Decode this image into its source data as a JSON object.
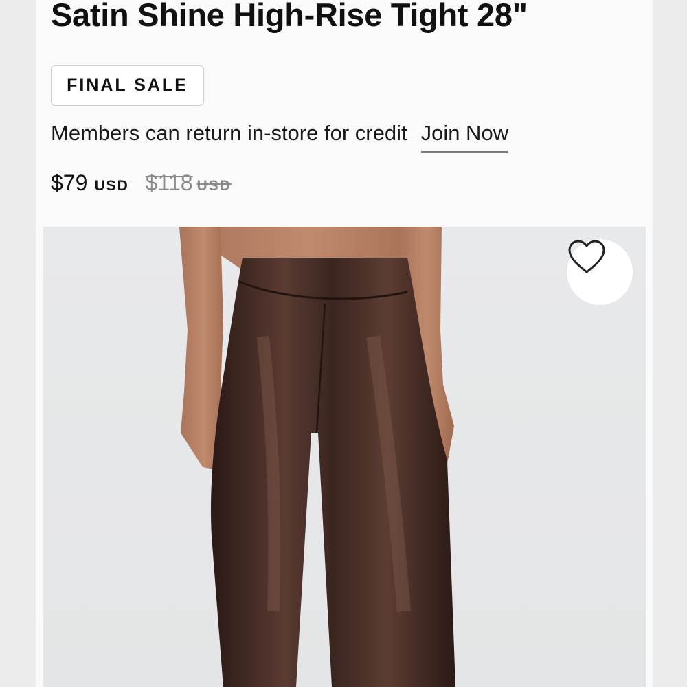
{
  "product": {
    "title": "Satin Shine High-Rise Tight 28\"",
    "badge": "FINAL SALE",
    "member_text": "Members can return in-store for credit",
    "join_link": "Join Now",
    "price": {
      "current": "$79",
      "current_currency": "USD",
      "original": "$118",
      "original_currency": "USD"
    },
    "image": {
      "favorite_icon": "heart-outline-icon",
      "garment_color": "#3b2620",
      "background_color": "#e6e7e8"
    }
  }
}
